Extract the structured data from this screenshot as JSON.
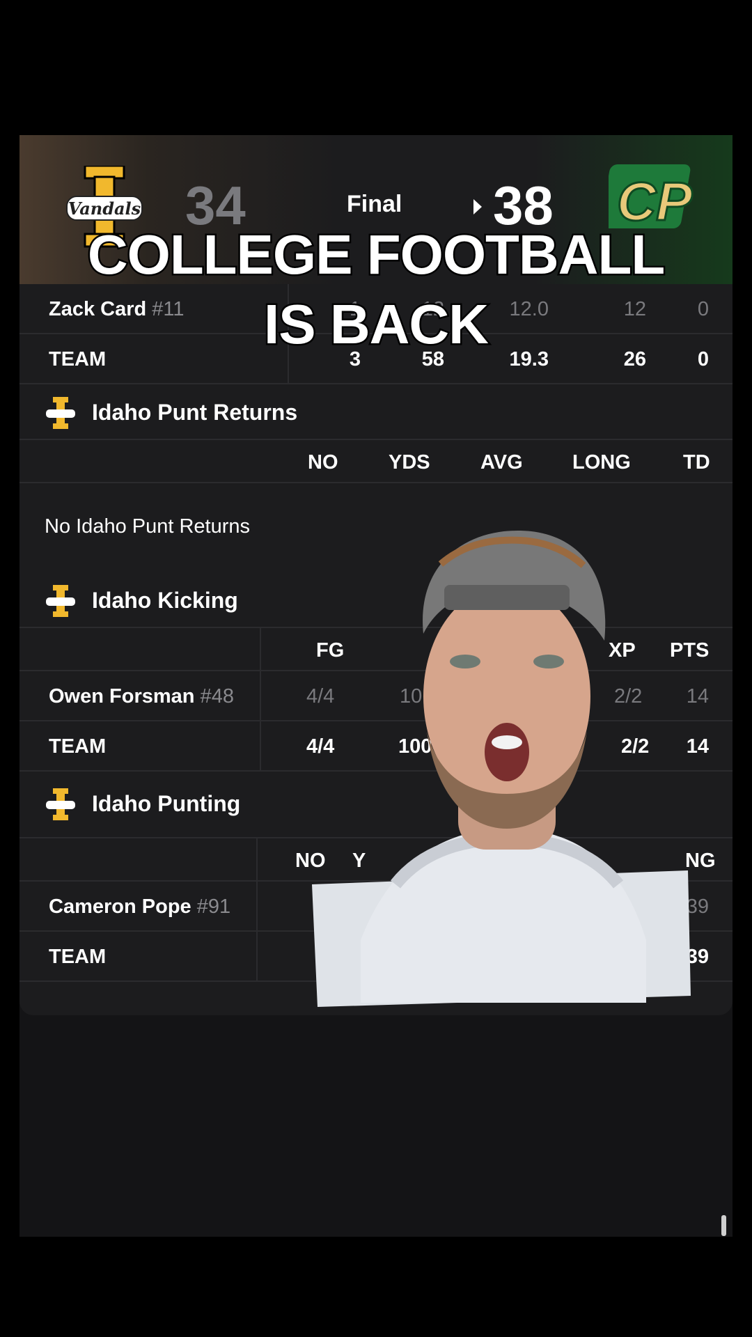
{
  "scoreboard": {
    "away_score": "34",
    "status": "Final",
    "home_score": "38",
    "away_logo_text": "Vandals",
    "home_logo_text": "CP"
  },
  "overlay_caption": {
    "line1": "COLLEGE FOOTBALL",
    "line2": "IS BACK"
  },
  "kick_returns_partial": {
    "rows": [
      {
        "name": "Zack Card",
        "number": "#11",
        "c1": "1",
        "c2": "12",
        "avg": "12.0",
        "long": "12",
        "td": "0"
      },
      {
        "name": "TEAM",
        "number": "",
        "c1": "3",
        "c2": "58",
        "avg": "19.3",
        "long": "26",
        "td": "0"
      }
    ]
  },
  "punt_returns": {
    "title": "Idaho Punt Returns",
    "columns": [
      "NO",
      "YDS",
      "AVG",
      "LONG",
      "TD"
    ],
    "empty_text": "No Idaho Punt Returns"
  },
  "kicking": {
    "title": "Idaho Kicking",
    "columns_visible": [
      "FG",
      "XP",
      "PTS"
    ],
    "rows": [
      {
        "name": "Owen Forsman",
        "number": "#48",
        "fg": "4/4",
        "pct_partial": "10",
        "xp": "2/2",
        "pts": "14"
      },
      {
        "name": "TEAM",
        "number": "",
        "fg": "4/4",
        "pct_partial": "100",
        "xp": "2/2",
        "pts": "14"
      }
    ]
  },
  "punting": {
    "title": "Idaho Punting",
    "columns_visible": [
      "NO",
      "Y",
      "NG"
    ],
    "rows": [
      {
        "name": "Cameron Pope",
        "number": "#91",
        "last": "39"
      },
      {
        "name": "TEAM",
        "number": "",
        "last": "39"
      }
    ]
  },
  "colors": {
    "idaho_gold": "#f1b82d",
    "calpoly_green": "#1e7a3a",
    "calpoly_gold": "#e8c97a"
  }
}
